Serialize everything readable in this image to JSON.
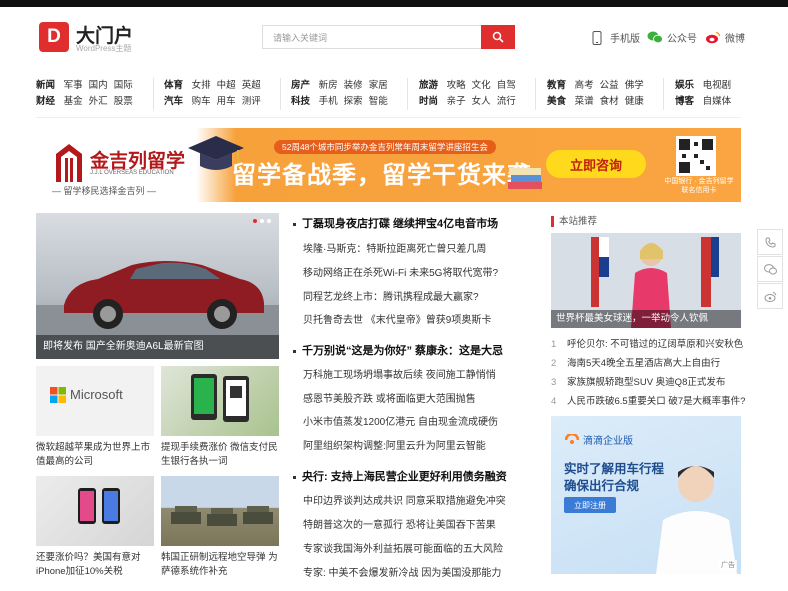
{
  "header": {
    "logo_char": "D",
    "site_name": "大门户",
    "site_sub": "WordPress主题",
    "search_placeholder": "请输入关键词",
    "links": [
      {
        "label": "手机版"
      },
      {
        "label": "公众号"
      },
      {
        "label": "微博"
      }
    ]
  },
  "nav": {
    "groups": [
      {
        "row1": [
          "新闻",
          "军事",
          "国内",
          "国际"
        ],
        "row2": [
          "财经",
          "基金",
          "外汇",
          "股票"
        ]
      },
      {
        "row1": [
          "体育",
          "女排",
          "中超",
          "英超"
        ],
        "row2": [
          "汽车",
          "购车",
          "用车",
          "测评"
        ]
      },
      {
        "row1": [
          "房产",
          "新房",
          "装修",
          "家居"
        ],
        "row2": [
          "科技",
          "手机",
          "探索",
          "智能"
        ]
      },
      {
        "row1": [
          "旅游",
          "攻略",
          "文化",
          "自驾"
        ],
        "row2": [
          "时尚",
          "亲子",
          "女人",
          "流行"
        ]
      },
      {
        "row1": [
          "教育",
          "高考",
          "公益",
          "佛学"
        ],
        "row2": [
          "美食",
          "菜谱",
          "食材",
          "健康"
        ]
      },
      {
        "row1": [
          "娱乐",
          "电视剧"
        ],
        "row2": [
          "博客",
          "自媒体"
        ]
      }
    ]
  },
  "banner": {
    "brand_name": "金吉列留学",
    "brand_en": "J.J.L OVERSEAS EDUCATION",
    "brand_slogan": "— 留学移民选择金吉列 —",
    "top_line": "52周48个城市同步举办金吉列常年周末留学讲座招生会",
    "headline": "留学备战季，留学干货来袭",
    "cta": "立即咨询",
    "qr_note": "中国银行 · 金吉列留学 联名信用卡"
  },
  "feature": {
    "caption": "即将发布 国产全新奥迪A6L最新官图"
  },
  "thumbs": [
    {
      "caption": "微软超越苹果成为世界上市值最高的公司",
      "brand_text": "Microsoft"
    },
    {
      "caption": "提现手续费涨价 微信支付民生银行各执一词"
    },
    {
      "caption": "还要涨价吗？美国有意对iPhone加征10%关税"
    },
    {
      "caption": "韩国正研制远程地空导弹 为萨德系统作补充"
    }
  ],
  "news": {
    "groups": [
      {
        "headline": "丁磊现身夜店打碟 继续押宝4亿电音市场",
        "items": [
          "埃隆·马斯克：特斯拉距离死亡曾只差几周",
          "移动网络正在杀死Wi-Fi 未来5G将取代宽带?",
          "同程艺龙终上市：腾讯携程成最大赢家?",
          "贝托鲁奇去世 《末代皇帝》曾获9项奥斯卡"
        ]
      },
      {
        "headline": "千万别说“这是为你好” 蔡康永：这是大忌",
        "items": [
          "万科施工现场坍塌事故后续 夜间施工静悄悄",
          "感恩节美股齐跌 或将面临更大范围抛售",
          "小米市值蒸发1200亿港元 自由现金流成硬伤",
          "阿里组织架构调整:阿里云升为阿里云智能"
        ]
      },
      {
        "headline": "央行: 支持上海民营企业更好利用债务融资",
        "items": [
          "中印边界谈判达成共识 同意采取措施避免冲突",
          "特朗普这次的一意孤行 恐将让美国吞下苦果",
          "专家谈我国海外利益拓展可能面临的五大风险",
          "专家: 中美不会爆发新冷战 因为美国没那能力"
        ]
      }
    ]
  },
  "right": {
    "section_title": "本站推荐",
    "image_caption": "世界杯最美女球迷，一举动令人钦佩",
    "list": [
      {
        "num": "1",
        "text": "呼伦贝尔: 不可错过的辽阔草原和兴安秋色"
      },
      {
        "num": "2",
        "text": "海南5天4晚全五星酒店高大上自由行"
      },
      {
        "num": "3",
        "text": "家族旗舰轿跑型SUV 奥迪Q8正式发布"
      },
      {
        "num": "4",
        "text": "人民币跌破6.5重要关口 破7是大概率事件?"
      }
    ],
    "ad": {
      "brand": "滴滴企业版",
      "line1": "实时了解用车行程",
      "line2": "确保出行合规",
      "cta": "立即注册",
      "tag": "广告"
    }
  },
  "colors": {
    "accent": "#e02d2d",
    "banner_orange": "#f7a13b",
    "cta_yellow": "#ffd91c"
  }
}
